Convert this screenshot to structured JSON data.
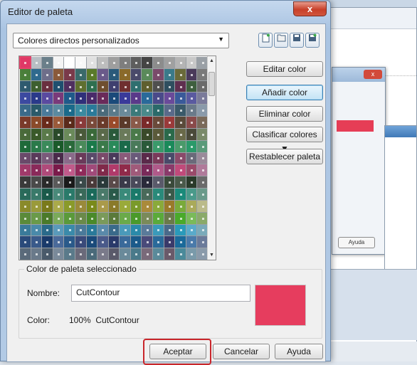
{
  "dialog": {
    "title": "Editor de paleta",
    "close_glyph": "x",
    "palette_select": {
      "value": "Colores directos personalizados",
      "arrow": "▼"
    },
    "toolbar_icons": [
      "new-palette-icon",
      "open-folder-icon",
      "save-icon",
      "save-as-icon"
    ],
    "buttons": {
      "edit": "Editar color",
      "add": "Añadir color",
      "delete": "Eliminar color",
      "sort": "Clasificar colores ▼",
      "reset": "Restablecer paleta"
    },
    "selected_group": {
      "title": "Color de paleta seleccionado",
      "name_label": "Nombre:",
      "name_value": "CutContour",
      "color_label": "Color:",
      "color_value": "100%  CutContour",
      "preview_color": "#e63d5e"
    },
    "footer": {
      "ok": "Aceptar",
      "cancel": "Cancelar",
      "help": "Ayuda"
    }
  },
  "background_window": {
    "button_label": "Ayuda"
  },
  "swatches": [
    "#e03866",
    "#b8bec4",
    "#6a7f8a",
    "#f4f4f4",
    "#ffffff",
    "#f8f8f8",
    "#e0e0e0",
    "#bdbdbd",
    "#9e9e9e",
    "#7e7e7e",
    "#5e5e5e",
    "#444444",
    "#8c8c8c",
    "#a0a0a0",
    "#b4b4b4",
    "#c8c8c8",
    "#9aa0a6",
    "#4a7f3a",
    "#2f6a8e",
    "#6e6e8a",
    "#8a5a3a",
    "#7a3a4a",
    "#3a6a6a",
    "#5a7a2a",
    "#6a5a8a",
    "#2a5a7a",
    "#8a6a2a",
    "#4a4a6a",
    "#5a8a5a",
    "#7a4a6a",
    "#3a7a8a",
    "#6a6a3a",
    "#4a3a5a",
    "#7a7a7a",
    "#2f5a6f",
    "#3e5f2f",
    "#6a2f3f",
    "#1f4f6f",
    "#4f2f5f",
    "#5f6f2f",
    "#2f6f4f",
    "#6f4f2f",
    "#3f3f6f",
    "#6f2f2f",
    "#2f6f6f",
    "#5f5f2f",
    "#4f4f4f",
    "#2f4f5f",
    "#5f2f4f",
    "#3f5f3f",
    "#6a6a6a",
    "#3c4aa0",
    "#2a3a8a",
    "#5a4aa0",
    "#7a3a7a",
    "#1f5a8a",
    "#2f2f7a",
    "#4a2a6a",
    "#6a2a5a",
    "#1a4a7a",
    "#3a3a9a",
    "#5a3a8a",
    "#2a6a9a",
    "#4a4a8a",
    "#6a4a9a",
    "#3a5a9a",
    "#5a5aa0",
    "#7a7a9a",
    "#3a6a8a",
    "#2a5a6a",
    "#4a7a9a",
    "#5a8aa0",
    "#1a6a8a",
    "#3a8aa0",
    "#2a7a9a",
    "#4a6a7a",
    "#5a7a8a",
    "#6a8a9a",
    "#3a7a7a",
    "#4a8a8a",
    "#2a6a6a",
    "#5a6a8a",
    "#3a5a6a",
    "#6a7a8a",
    "#8a9aaa",
    "#7a3a2a",
    "#8a4a2a",
    "#6a2a1a",
    "#9a5a3a",
    "#5a2a1a",
    "#8a3a3a",
    "#7a4a3a",
    "#6a3a2a",
    "#9a4a2a",
    "#5a3a2a",
    "#8a5a4a",
    "#7a2a2a",
    "#6a4a3a",
    "#9a3a3a",
    "#5a4a3a",
    "#8a4a4a",
    "#7a6a5a",
    "#4a6a3a",
    "#3a5a2a",
    "#5a7a4a",
    "#2a4a2a",
    "#6a8a5a",
    "#4a5a3a",
    "#3a6a3a",
    "#5a6a4a",
    "#2a5a3a",
    "#6a7a5a",
    "#4a7a4a",
    "#3a4a2a",
    "#5a5a3a",
    "#2a6a4a",
    "#6a6a4a",
    "#4a4a3a",
    "#7a8a6a",
    "#1f6a3a",
    "#2a7a4a",
    "#3a8a5a",
    "#1a5a2a",
    "#2a6a3a",
    "#4a8a5a",
    "#1a7a4a",
    "#3a7a4a",
    "#2a8a5a",
    "#1a6a4a",
    "#4a7a5a",
    "#2a5a3a",
    "#3a9a6a",
    "#1a8a5a",
    "#4a9a6a",
    "#2a9a6a",
    "#5a9a7a",
    "#6a4a6a",
    "#5a3a5a",
    "#7a5a7a",
    "#4a2a4a",
    "#8a6a8a",
    "#6a3a5a",
    "#5a4a6a",
    "#7a4a6a",
    "#4a3a5a",
    "#8a5a7a",
    "#6a5a7a",
    "#5a2a4a",
    "#7a3a5a",
    "#4a4a6a",
    "#8a4a6a",
    "#6a6a7a",
    "#9a8a9a",
    "#a03a6a",
    "#8a2a5a",
    "#b04a7a",
    "#7a1a4a",
    "#c05a8a",
    "#902a5a",
    "#a04a7a",
    "#802a4a",
    "#b03a6a",
    "#902a4a",
    "#a05a7a",
    "#7a2a5a",
    "#b05a8a",
    "#8a3a6a",
    "#c04a7a",
    "#9a4a6a",
    "#b07a9a",
    "#3a3a3a",
    "#4a4a4a",
    "#2a2a2a",
    "#5a5a5a",
    "#1a1a1a",
    "#3a4a4a",
    "#4a3a3a",
    "#2a3a3a",
    "#5a4a4a",
    "#3a3a4a",
    "#4a4a5a",
    "#2a2a3a",
    "#5a5a6a",
    "#3a4a3a",
    "#4a5a4a",
    "#2a3a2a",
    "#6a6a6a",
    "#2a6a5a",
    "#3a7a6a",
    "#1a5a4a",
    "#4a8a7a",
    "#2a7a6a",
    "#3a6a5a",
    "#1a6a5a",
    "#4a7a6a",
    "#2a5a4a",
    "#3a8a7a",
    "#1a7a6a",
    "#4a6a5a",
    "#2a8a7a",
    "#3a5a4a",
    "#1a8a7a",
    "#4a9a8a",
    "#6a9a8a",
    "#8a8a2a",
    "#9a9a3a",
    "#7a7a1a",
    "#aaaa4a",
    "#8a9a2a",
    "#9a8a3a",
    "#7a8a1a",
    "#aa9a4a",
    "#8a7a2a",
    "#9aaa3a",
    "#7a9a2a",
    "#aa8a3a",
    "#8aaa3a",
    "#9a7a2a",
    "#7aaa3a",
    "#aaaa5a",
    "#baba8a",
    "#5a8a3a",
    "#6a9a4a",
    "#4a7a2a",
    "#7aaa5a",
    "#5a9a3a",
    "#6a8a4a",
    "#4a8a2a",
    "#7a9a5a",
    "#5a7a3a",
    "#6aaa4a",
    "#4a9a2a",
    "#7a8a5a",
    "#5aaa3a",
    "#6a7a4a",
    "#4aaa2a",
    "#7aba5a",
    "#8aaa6a",
    "#3a7a9a",
    "#4a8aaa",
    "#2a6a8a",
    "#5a9aba",
    "#3a8aaa",
    "#4a7a9a",
    "#2a7a9a",
    "#5a8aaa",
    "#3a6a8a",
    "#4a9aba",
    "#2a8aaa",
    "#5a7a9a",
    "#3a9aba",
    "#4a6a8a",
    "#2a9aba",
    "#5aaaca",
    "#7aaaba",
    "#2a4a7a",
    "#3a5a8a",
    "#1a3a6a",
    "#4a6a9a",
    "#2a5a8a",
    "#3a4a7a",
    "#1a4a7a",
    "#4a5a8a",
    "#2a3a6a",
    "#3a6a9a",
    "#1a5a8a",
    "#4a4a7a",
    "#2a6a9a",
    "#3a3a6a",
    "#1a6a9a",
    "#4a7aaa",
    "#6a7a9a",
    "#5a6a7a",
    "#6a7a8a",
    "#4a5a6a",
    "#7a8a9a",
    "#5a7a8a",
    "#6a6a7a",
    "#4a6a7a",
    "#7a7a8a",
    "#5a5a6a",
    "#6a8a9a",
    "#4a7a8a",
    "#7a6a7a",
    "#5a8a9a",
    "#6a5a6a",
    "#4a8a9a",
    "#7a9aaa",
    "#8a9aaa"
  ]
}
